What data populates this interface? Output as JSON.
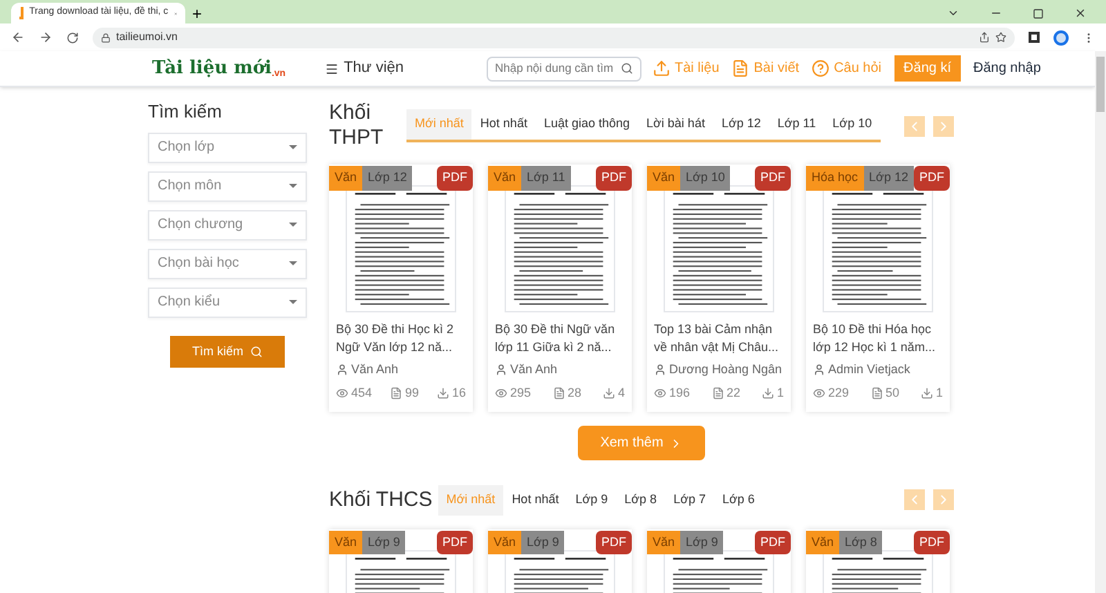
{
  "browser": {
    "tab_title": "Trang download tài liệu, đề thi, c",
    "new_tab": "+",
    "url": "tailieumoi.vn"
  },
  "header": {
    "logo": "Tài liệu mới",
    "logo_suffix": ".vn",
    "library": "Thư viện",
    "search": {
      "placeholder": "Nhập nội dung cần tìm"
    },
    "nav": [
      {
        "label": "Tài liệu",
        "kind": "link"
      },
      {
        "label": "Bài viết",
        "kind": "link"
      },
      {
        "label": "Câu hỏi",
        "kind": "link"
      },
      {
        "label": "Đăng kí",
        "kind": "primary"
      },
      {
        "label": "Đăng nhập",
        "kind": "plain"
      }
    ]
  },
  "sidebar": {
    "title": "Tìm kiếm",
    "selects": [
      {
        "placeholder": "Chọn lớp"
      },
      {
        "placeholder": "Chọn môn"
      },
      {
        "placeholder": "Chọn chương"
      },
      {
        "placeholder": "Chọn bài học"
      },
      {
        "placeholder": "Chọn kiểu"
      }
    ],
    "button": "Tìm kiếm"
  },
  "sections": [
    {
      "title": "Khối THPT",
      "tabs": [
        {
          "label": "Mới nhất",
          "selected": true
        },
        {
          "label": "Hot nhất",
          "selected": false
        },
        {
          "label": "Luật giao thông",
          "selected": false
        },
        {
          "label": "Lời bài hát",
          "selected": false
        },
        {
          "label": "Lớp 12",
          "selected": false
        },
        {
          "label": "Lớp 11",
          "selected": false
        },
        {
          "label": "Lớp 10",
          "selected": false
        }
      ],
      "cards": [
        {
          "subject": "Văn",
          "grade": "Lớp 12",
          "format": "PDF",
          "title": "Bộ 30 Đề thi Học kì 2 Ngữ Văn lớp 12 nă...",
          "author": "Văn Anh",
          "views": "454",
          "pages": "99",
          "downloads": "16"
        },
        {
          "subject": "Văn",
          "grade": "Lớp 11",
          "format": "PDF",
          "title": "Bộ 30 Đề thi Ngữ văn lớp 11 Giữa kì 2 nă...",
          "author": "Văn Anh",
          "views": "295",
          "pages": "28",
          "downloads": "4"
        },
        {
          "subject": "Văn",
          "grade": "Lớp 10",
          "format": "PDF",
          "title": "Top 13 bài Cảm nhận về nhân vật Mị Châu...",
          "author": "Dương Hoàng Ngân",
          "views": "196",
          "pages": "22",
          "downloads": "1"
        },
        {
          "subject": "Hóa học",
          "grade": "Lớp 12",
          "format": "PDF",
          "title": "Bộ 10 Đề thi Hóa học lớp 12 Học kì 1 năm...",
          "author": "Admin Vietjack",
          "views": "229",
          "pages": "50",
          "downloads": "1"
        }
      ],
      "more": "Xem thêm"
    },
    {
      "title": "Khối THCS",
      "tabs": [
        {
          "label": "Mới nhất",
          "selected": true
        },
        {
          "label": "Hot nhất",
          "selected": false
        },
        {
          "label": "Lớp 9",
          "selected": false
        },
        {
          "label": "Lớp 8",
          "selected": false
        },
        {
          "label": "Lớp 7",
          "selected": false
        },
        {
          "label": "Lớp 6",
          "selected": false
        }
      ],
      "cards": [
        {
          "subject": "Văn",
          "grade": "Lớp 9",
          "format": "PDF"
        },
        {
          "subject": "Văn",
          "grade": "Lớp 9",
          "format": "PDF"
        },
        {
          "subject": "Văn",
          "grade": "Lớp 9",
          "format": "PDF"
        },
        {
          "subject": "Văn",
          "grade": "Lớp 8",
          "format": "PDF"
        }
      ]
    }
  ]
}
